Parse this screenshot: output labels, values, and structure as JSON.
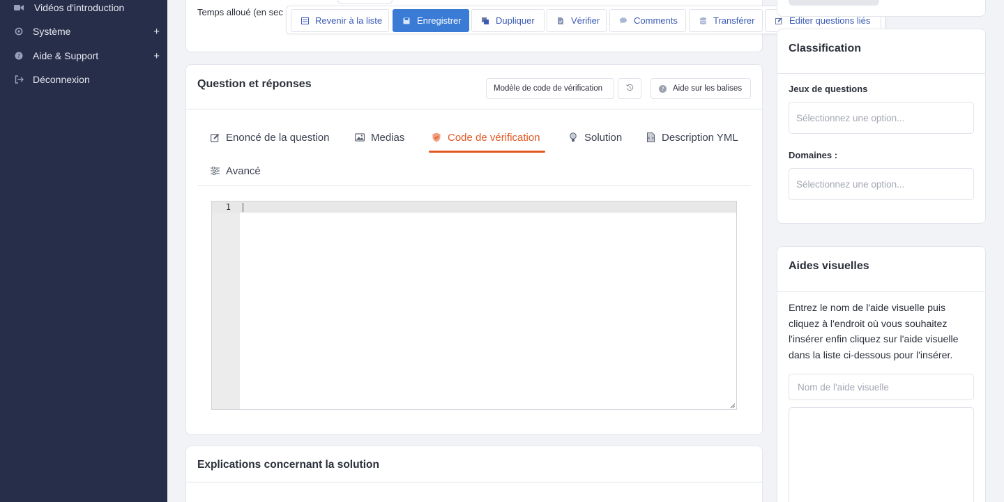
{
  "sidebar": {
    "items": [
      {
        "label": "Vidéos d'introduction",
        "icon": "video-icon"
      },
      {
        "label": "Système",
        "icon": "gear-icon",
        "expandable": true
      },
      {
        "label": "Aide & Support",
        "icon": "help-circle-icon",
        "expandable": true
      },
      {
        "label": "Déconnexion",
        "icon": "logout-icon"
      }
    ],
    "expand_symbol": "+"
  },
  "top_card": {
    "temps_label": "Temps alloué (en sec"
  },
  "toolbar": {
    "buttons": [
      {
        "label": "Revenir à la liste",
        "icon": "list-icon"
      },
      {
        "label": "Enregistrer",
        "icon": "save-icon",
        "primary": true
      },
      {
        "label": "Dupliquer",
        "icon": "copy-icon"
      },
      {
        "label": "Vérifier",
        "icon": "file-check-icon"
      },
      {
        "label": "Comments",
        "icon": "comment-icon"
      },
      {
        "label": "Transférer",
        "icon": "database-icon"
      },
      {
        "label": "Editer questions liés",
        "icon": "edit-icon"
      }
    ]
  },
  "qa_card": {
    "title": "Question et réponses",
    "template_button": "Modèle de code de vérification",
    "history_button_icon": "history-icon",
    "tags_help_button": "Aide sur les balises",
    "tabs": [
      {
        "label": "Enoncé de la question",
        "icon": "edit-icon"
      },
      {
        "label": "Medias",
        "icon": "image-icon"
      },
      {
        "label": "Code de vérification",
        "icon": "shield-check-icon",
        "active": true
      },
      {
        "label": "Solution",
        "icon": "lightbulb-icon"
      },
      {
        "label": "Description YML",
        "icon": "file-code-icon"
      },
      {
        "label": "Avancé",
        "icon": "sliders-icon"
      }
    ],
    "editor": {
      "line_numbers": [
        "1"
      ],
      "content": ""
    }
  },
  "explanations_card": {
    "title": "Explications concernant la solution"
  },
  "classification": {
    "title": "Classification",
    "question_sets_label": "Jeux de questions",
    "question_sets_placeholder": "Sélectionnez une option...",
    "domains_label": "Domaines :",
    "domains_placeholder": "Sélectionnez une option..."
  },
  "visual_aids": {
    "title": "Aides visuelles",
    "help_text": "Entrez le nom de l'aide visuelle puis cliquez à l'endroit où vous souhaitez l'insérer enfin cliquez sur l'aide visuelle dans la liste ci-dessous pour l'insérer.",
    "name_placeholder": "Nom de l'aide visuelle"
  },
  "colors": {
    "sidebar_bg": "#272e4a",
    "accent": "#e25822",
    "primary": "#3a7bd5",
    "link": "#3b5bb5"
  }
}
